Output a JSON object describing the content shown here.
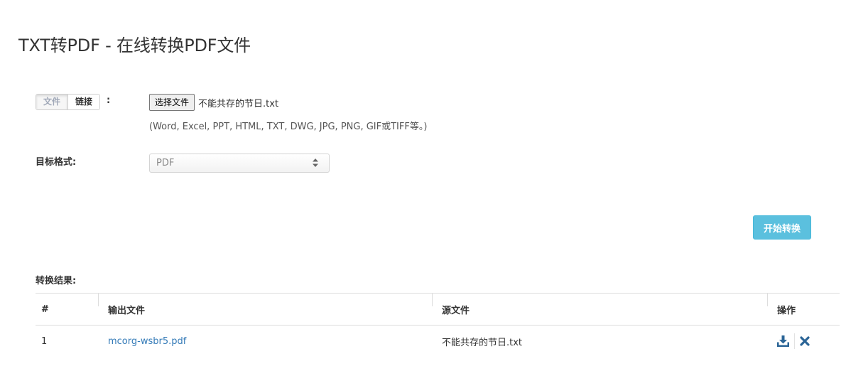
{
  "page": {
    "title": "TXT转PDF - 在线转换PDF文件"
  },
  "source": {
    "tabs": [
      {
        "label": "文件",
        "active": true
      },
      {
        "label": "链接",
        "active": false
      }
    ],
    "colon": ":",
    "choose_file_label": "选择文件",
    "chosen_file": "不能共存的节日.txt",
    "format_hint": "(Word, Excel, PPT, HTML, TXT, DWG, JPG, PNG, GIF或TIFF等。)"
  },
  "target": {
    "label": "目标格式:",
    "selected": "PDF"
  },
  "actions": {
    "start_label": "开始转换"
  },
  "results": {
    "label": "转换结果:",
    "columns": [
      "#",
      "输出文件",
      "源文件",
      "操作"
    ],
    "rows": [
      {
        "index": "1",
        "output": "mcorg-wsbr5.pdf",
        "source": "不能共存的节日.txt"
      }
    ]
  },
  "colors": {
    "accent": "#5bc0de",
    "link": "#337ab7",
    "icon": "#2a6496"
  }
}
